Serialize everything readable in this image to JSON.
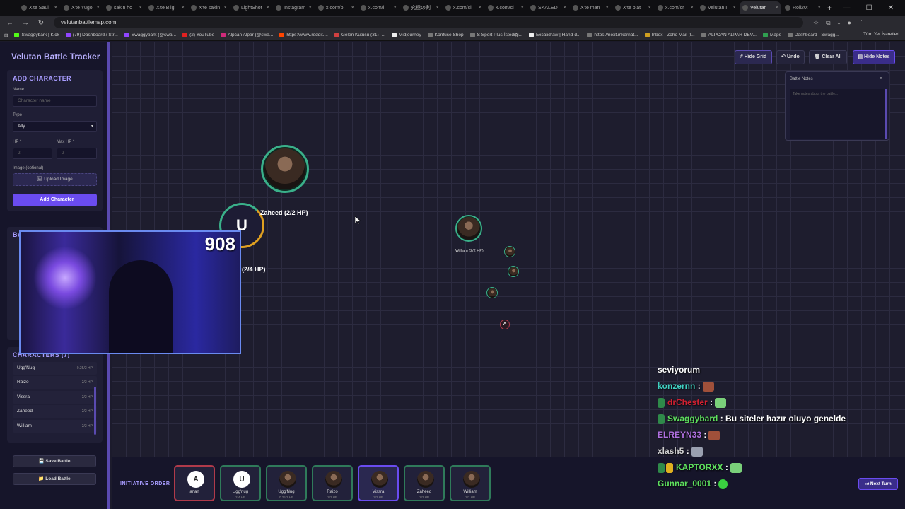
{
  "browser": {
    "tabs": [
      "X'te Saul",
      "X'te Yugo",
      "sakin ho",
      "X'te Bilgi",
      "X'te sakin",
      "LightShot",
      "Instagram",
      "x.com/p",
      "x.com/i",
      "究極の剣",
      "x.com/cl",
      "x.com/cl",
      "SKALED",
      "X'te man",
      "X'te plat",
      "x.com/cr",
      "Velutan I",
      "Velutan",
      "Roll20:"
    ],
    "url": "velutanbattlemap.com",
    "bookmarks": [
      "Swaggybark | Kick",
      "(79) Dashboard / Str...",
      "Swaggybark (@swa...",
      "(2) YouTube",
      "Alpcan Alpar (@swa...",
      "https://www.reddit....",
      "Gelen Kutusu (31) -...",
      "Midjourney",
      "Konfuse Shop",
      "S Sport Plus-İstediği...",
      "Excalidraw | Hand-d...",
      "https://next.inkarnat...",
      "Inbox - Zoho Mail (l...",
      "ALPCAN ALPAR DEV...",
      "Maps",
      "Dashboard - Swagg..."
    ],
    "bookmarks_right": "Tüm Yer İşaretleri"
  },
  "app": {
    "title": "Velutan Battle Tracker",
    "add_character": {
      "heading": "ADD CHARACTER",
      "name_label": "Name",
      "name_placeholder": "Character name",
      "type_label": "Type",
      "type_value": "Ally",
      "hp_label": "HP *",
      "hp_placeholder": "2",
      "maxhp_label": "Max HP *",
      "maxhp_placeholder": "2",
      "image_label": "Image (optional)",
      "upload_label": "Upload Image",
      "add_button": "Add Character"
    },
    "hidden_panel_fragment": "BA",
    "characters": {
      "heading": "CHARACTERS (7)",
      "items": [
        {
          "name": "Ugg'Nug",
          "hp": "0.25/2 HP"
        },
        {
          "name": "Raizo",
          "hp": "2/2 HP"
        },
        {
          "name": "Vissra",
          "hp": "2/2 HP"
        },
        {
          "name": "Zaheed",
          "hp": "2/2 HP"
        },
        {
          "name": "William",
          "hp": "2/2 HP"
        }
      ]
    },
    "save_button": "Save Battle",
    "load_button": "Load Battle"
  },
  "map": {
    "buttons": {
      "hide_grid": "# Hide Grid",
      "undo": "↶ Undo",
      "clear_all": "🗑 Clear All",
      "hide_notes": "Hide Notes"
    },
    "notes": {
      "title": "Battle Notes",
      "placeholder": "Take notes about the battle..."
    },
    "tokens": {
      "zaheed_label": "Zaheed (2/2 HP)",
      "u_letter": "U",
      "u_label": "(2/4 HP)",
      "william_label": "William (2/2 HP)",
      "a_letter": "A"
    }
  },
  "webcam": {
    "counter": "908"
  },
  "initiative": {
    "label": "INITIATIVE ORDER",
    "cards": [
      {
        "letter": "A",
        "name": "anan",
        "hp": ""
      },
      {
        "letter": "U",
        "name": "Ugg'nug",
        "hp": "2/4 HP"
      },
      {
        "letter": "",
        "name": "Ugg'Nug",
        "hp": "0.25/2 HP"
      },
      {
        "letter": "",
        "name": "Raizo",
        "hp": "2/2 HP"
      },
      {
        "letter": "",
        "name": "Vissra",
        "hp": "2/2 HP"
      },
      {
        "letter": "",
        "name": "Zaheed",
        "hp": "2/2 HP"
      },
      {
        "letter": "",
        "name": "William",
        "hp": "2/2 HP"
      }
    ],
    "next_turn": "Next Turn"
  },
  "chat": [
    {
      "user": "",
      "text": "seviyorum",
      "color": "#ffffff"
    },
    {
      "user": "konzernn",
      "text": ":",
      "color": "#3fd0c0"
    },
    {
      "user": "drChester",
      "text": ":",
      "color": "#d02030"
    },
    {
      "user": "Swaggybard",
      "text": ": Bu siteler hazır oluyo genelde",
      "color": "#5ee05e"
    },
    {
      "user": "ELREYN33",
      "text": ":",
      "color": "#b070e0"
    },
    {
      "user": "xlash5",
      "text": ":",
      "color": "#d0d0d0"
    },
    {
      "user": "KAPTORXX",
      "text": ":",
      "color": "#5ee05e"
    },
    {
      "user": "Gunnar_0001",
      "text": ":",
      "color": "#5ee05e"
    }
  ]
}
